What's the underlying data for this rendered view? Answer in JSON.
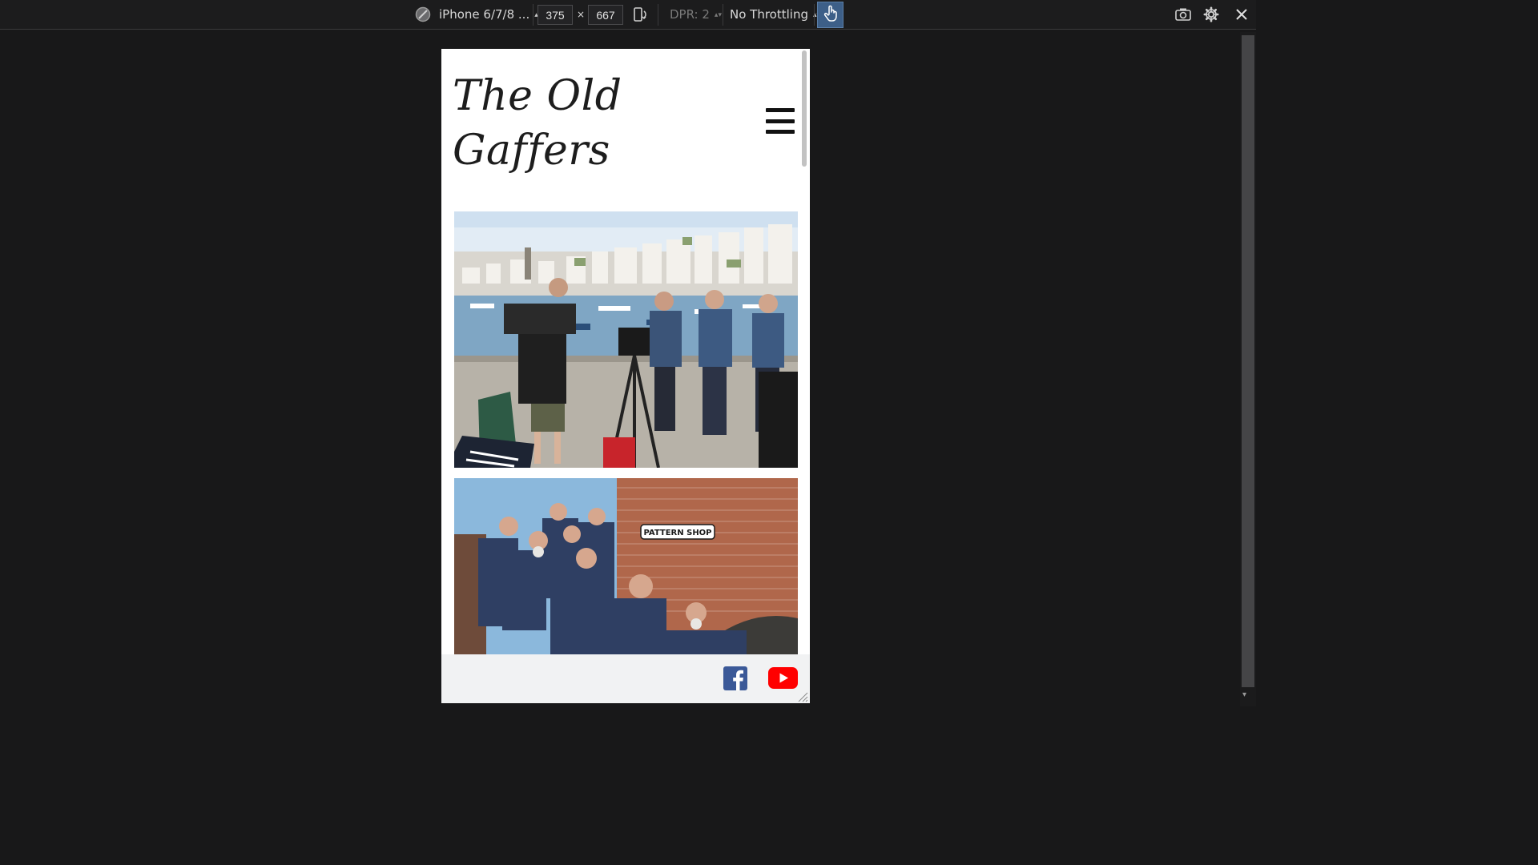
{
  "devtools": {
    "device_name": "iPhone 6/7/8 ...",
    "width": "375",
    "times": "×",
    "height": "667",
    "dpr": "DPR: 2",
    "throttling": "No Throttling",
    "icons": [
      "no-sign-icon",
      "rotate-device-icon",
      "touch-icon",
      "screenshot-icon",
      "settings-gear-icon",
      "close-icon"
    ]
  },
  "site": {
    "logo_line1": "The Old",
    "logo_line2": "Gaffers",
    "menu_icon": "hamburger-icon",
    "photo1_alt": "Film crew recording men in matching polo shirts by a harbour",
    "photo2_alt": "Group of men in polo shirts posing by a brick wall",
    "sign_text": "PATTERN SHOP",
    "footer_icons": [
      "facebook-icon",
      "youtube-icon"
    ]
  },
  "colors": {
    "devtools_bg": "#181819",
    "accent_blue": "#3d5f88",
    "facebook_blue": "#3b5998",
    "youtube_red": "#ff0000",
    "footer_bg": "#f1f2f3"
  }
}
